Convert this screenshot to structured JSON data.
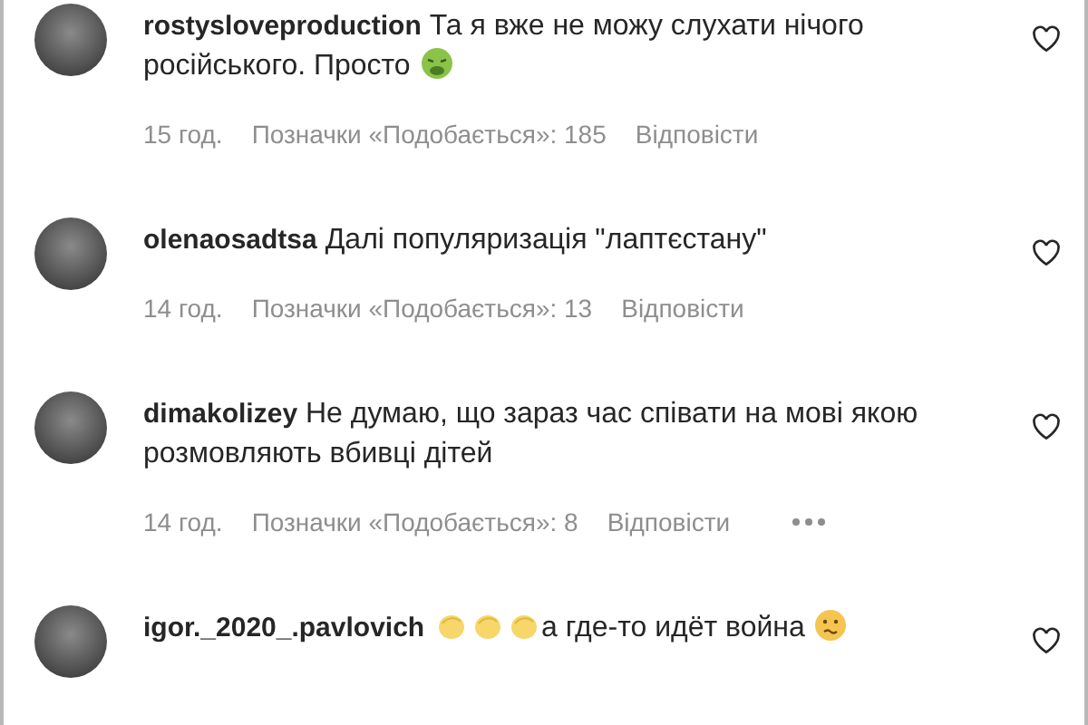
{
  "comments": [
    {
      "username": "rostysloveproduction",
      "parts": [
        {
          "kind": "text",
          "text": "Та я вже не можу слухати нічого російського. Просто"
        },
        {
          "kind": "nauseated"
        }
      ],
      "time": "15 год.",
      "likes": "Позначки «Подобається»: 185",
      "reply": "Відповісти",
      "more": false
    },
    {
      "username": "olenaosadtsa",
      "parts": [
        {
          "kind": "text",
          "text": "Далі популяризація \"лаптєстану\""
        }
      ],
      "time": "14 год.",
      "likes": "Позначки «Подобається»: 13",
      "reply": "Відповісти",
      "more": false
    },
    {
      "username": "dimakolizey",
      "parts": [
        {
          "kind": "text",
          "text": "Не думаю, що зараз час співати на мові якою розмовляють вбивці дітей"
        }
      ],
      "time": "14 год.",
      "likes": "Позначки «Подобається»: 8",
      "reply": "Відповісти",
      "more": true
    },
    {
      "username": "igor._2020_.pavlovich",
      "parts": [
        {
          "kind": "clap"
        },
        {
          "kind": "clap"
        },
        {
          "kind": "clap"
        },
        {
          "kind": "text",
          "text": "а где-то идёт война"
        },
        {
          "kind": "confused"
        }
      ]
    }
  ]
}
